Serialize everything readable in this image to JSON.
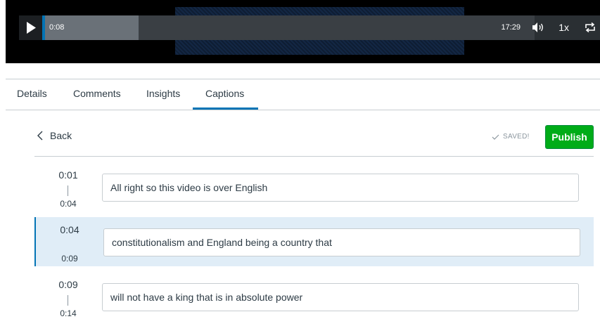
{
  "player": {
    "current_time": "0:08",
    "total_time": "17:29",
    "speed": "1x",
    "progress_fraction": 0.195,
    "accent_color": "#0374b5"
  },
  "tabs": [
    {
      "label": "Details"
    },
    {
      "label": "Comments"
    },
    {
      "label": "Insights"
    },
    {
      "label": "Captions",
      "active": true
    }
  ],
  "toolbar": {
    "back_label": "Back",
    "saved_label": "SAVED!",
    "publish_label": "Publish",
    "publish_color": "#00ac18"
  },
  "captions": [
    {
      "start": "0:01",
      "end": "0:04",
      "text": "All right so this video is over English",
      "active": false
    },
    {
      "start": "0:04",
      "end": "0:09",
      "text": "constitutionalism and England being a country that",
      "active": true
    },
    {
      "start": "0:09",
      "end": "0:14",
      "text": "will not have a king that is in absolute power",
      "active": false
    }
  ]
}
